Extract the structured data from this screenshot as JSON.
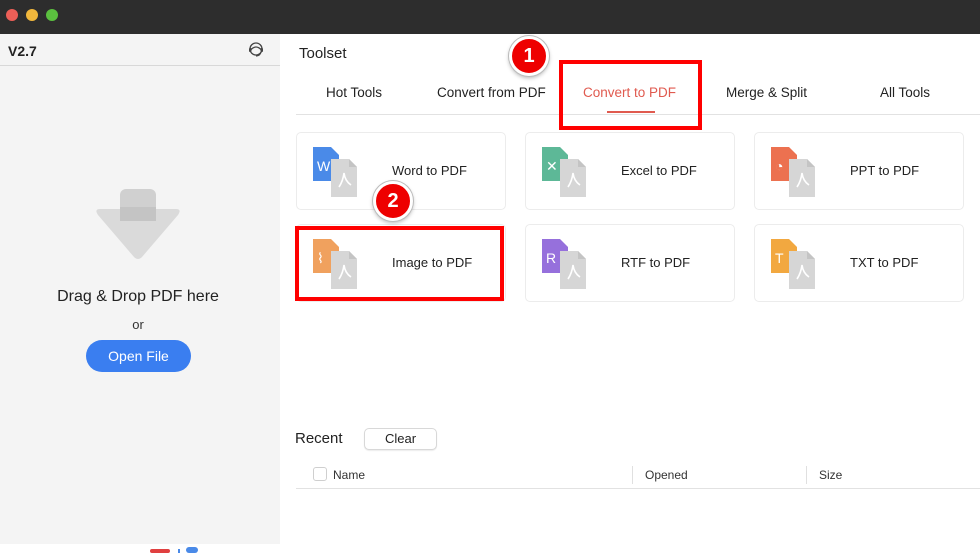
{
  "sidebar": {
    "version": "V2.7",
    "support_icon": "headset-icon",
    "drop_icon": "download-arrow-icon",
    "drop_text": "Drag & Drop PDF here",
    "or_text": "or",
    "open_file_label": "Open File"
  },
  "main": {
    "title": "Toolset",
    "tabs": [
      {
        "label": "Hot Tools",
        "active": false
      },
      {
        "label": "Convert from PDF",
        "active": false
      },
      {
        "label": "Convert to PDF",
        "active": true
      },
      {
        "label": "Merge & Split",
        "active": false
      },
      {
        "label": "All Tools",
        "active": false
      }
    ],
    "tools": [
      {
        "label": "Word to PDF",
        "icon": "word-to-pdf-icon",
        "glyph": "W",
        "color": "#4a8ae8"
      },
      {
        "label": "Excel to PDF",
        "icon": "excel-to-pdf-icon",
        "glyph": "✕",
        "color": "#5db897"
      },
      {
        "label": "PPT to PDF",
        "icon": "ppt-to-pdf-icon",
        "glyph": "◔",
        "color": "#ec7150"
      },
      {
        "label": "Image to PDF",
        "icon": "image-to-pdf-icon",
        "glyph": "⌇",
        "color": "#f0a15e"
      },
      {
        "label": "RTF to PDF",
        "icon": "rtf-to-pdf-icon",
        "glyph": "R",
        "color": "#9670dc"
      },
      {
        "label": "TXT to PDF",
        "icon": "txt-to-pdf-icon",
        "glyph": "T",
        "color": "#f2a840"
      }
    ],
    "recent": {
      "title": "Recent",
      "clear_label": "Clear",
      "columns": [
        "Name",
        "Opened",
        "Size"
      ],
      "rows": []
    }
  },
  "annotations": {
    "step1": "1",
    "step2": "2",
    "highlight_color": "#ff0000"
  },
  "colors": {
    "accent": "#e05a4f",
    "primary_button": "#3a7ef0"
  }
}
